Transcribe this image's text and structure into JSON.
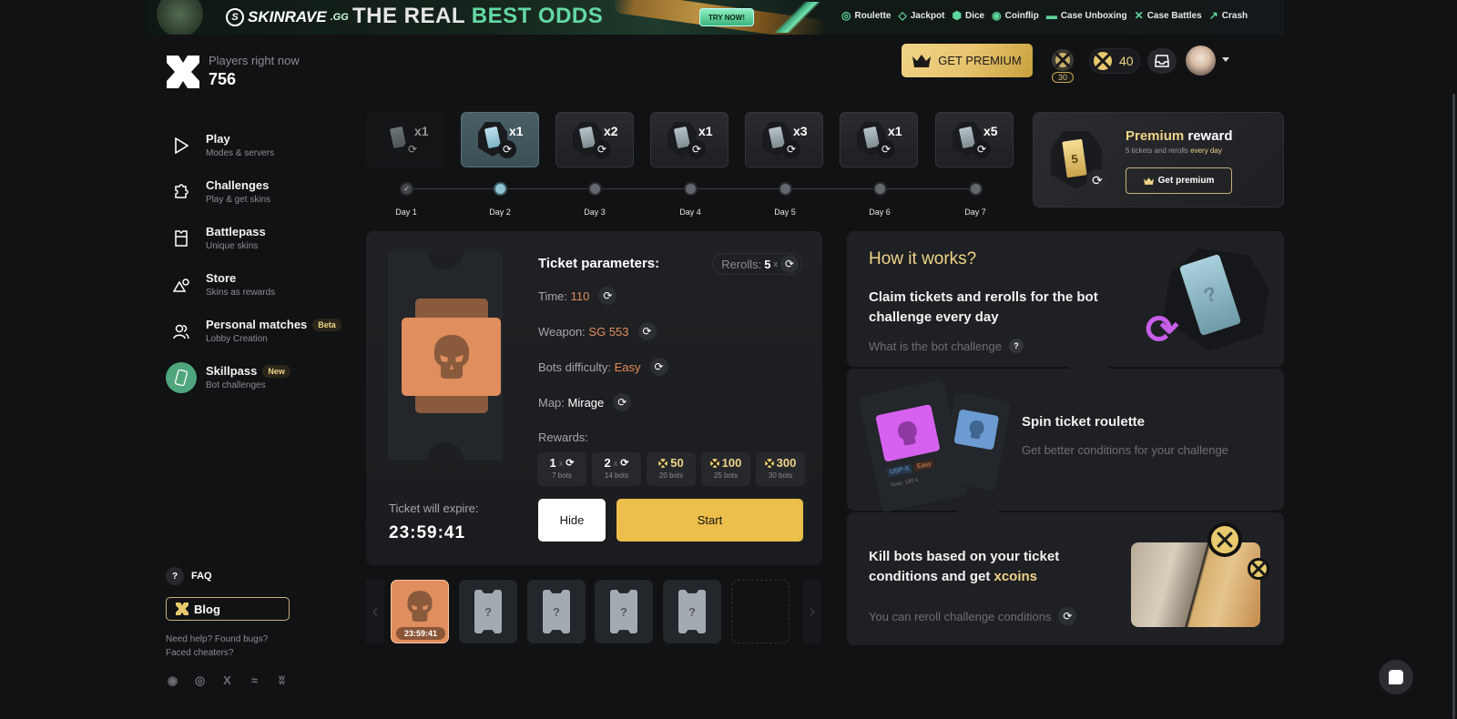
{
  "banner": {
    "brand": "SKINRAVE",
    "brand_suffix": ".GG",
    "headline_white": "THE REAL ",
    "headline_green": "BEST ODDS",
    "cta": "TRY NOW!",
    "games": [
      {
        "label": "Roulette",
        "icon": "roulette-icon"
      },
      {
        "label": "Jackpot",
        "icon": "diamond-icon"
      },
      {
        "label": "Dice",
        "icon": "dice-icon"
      },
      {
        "label": "Coinflip",
        "icon": "coin-icon"
      },
      {
        "label": "Case Unboxing",
        "icon": "case-icon"
      },
      {
        "label": "Case Battles",
        "icon": "swords-icon"
      },
      {
        "label": "Crash",
        "icon": "rocket-icon"
      }
    ]
  },
  "header": {
    "players_label": "Players right now",
    "players_count": "756",
    "premium_button": "GET PREMIUM",
    "level_badge": "30",
    "coins": "40"
  },
  "nav": [
    {
      "title": "Play",
      "sub": "Modes & servers",
      "icon": "play-icon"
    },
    {
      "title": "Challenges",
      "sub": "Play & get skins",
      "icon": "puzzle-icon"
    },
    {
      "title": "Battlepass",
      "sub": "Unique skins",
      "icon": "battlepass-icon"
    },
    {
      "title": "Store",
      "sub": "Skins as rewards",
      "icon": "shapes-icon"
    },
    {
      "title": "Personal matches",
      "sub": "Lobby Creation",
      "tag": "Beta",
      "icon": "users-icon"
    },
    {
      "title": "Skillpass",
      "sub": "Bot challenges",
      "tag": "New",
      "icon": "ticket-icon"
    }
  ],
  "footer": {
    "faq": "FAQ",
    "blog": "Blog",
    "help_line1": "Need help? Found bugs?",
    "help_line2": "Faced cheaters?",
    "social": [
      "discord",
      "instagram",
      "x",
      "steam",
      "vk"
    ]
  },
  "days": [
    {
      "label": "Day 1",
      "mult": "x1",
      "state": "done"
    },
    {
      "label": "Day 2",
      "mult": "x1",
      "state": "active"
    },
    {
      "label": "Day 3",
      "mult": "x2",
      "state": "upcoming"
    },
    {
      "label": "Day 4",
      "mult": "x1",
      "state": "upcoming"
    },
    {
      "label": "Day 5",
      "mult": "x3",
      "state": "upcoming"
    },
    {
      "label": "Day 6",
      "mult": "x1",
      "state": "upcoming"
    },
    {
      "label": "Day 7",
      "mult": "x5",
      "state": "upcoming"
    }
  ],
  "premium_card": {
    "title_gold": "Premium",
    "title_white": " reward",
    "sub_plain": "5 tickets and rerolls ",
    "sub_gold": "every day",
    "ticket_count": "5",
    "button": "Get premium"
  },
  "ticket": {
    "title": "Ticket parameters:",
    "rerolls_label": "Rerolls:",
    "rerolls_count": "5",
    "rerolls_x": "x",
    "params": [
      {
        "label": "Time:",
        "value": "110",
        "style": "accent"
      },
      {
        "label": "Weapon:",
        "value": "SG 553",
        "style": "accent"
      },
      {
        "label": "Bots difficulty:",
        "value": "Easy",
        "style": "accent"
      },
      {
        "label": "Map:",
        "value": "Mirage",
        "style": "white"
      }
    ],
    "rewards_label": "Rewards:",
    "rewards": [
      {
        "amount": "1",
        "type": "reroll",
        "bots": "7 bots"
      },
      {
        "amount": "2",
        "type": "reroll",
        "bots": "14 bots"
      },
      {
        "amount": "50",
        "type": "coin",
        "bots": "20 bots"
      },
      {
        "amount": "100",
        "type": "coin",
        "bots": "25 bots"
      },
      {
        "amount": "300",
        "type": "coin",
        "bots": "30 bots"
      }
    ],
    "expire_label": "Ticket will expire:",
    "expire_value": "23:59:41",
    "hide_button": "Hide",
    "start_button": "Start"
  },
  "carousel": {
    "selected_time": "23:59:41",
    "unknown_count": 4,
    "placeholder": "?"
  },
  "how": {
    "heading": "How it works?",
    "step1_title": "Claim tickets and rerolls for the bot challenge every day",
    "step1_link": "What is the bot challenge",
    "step2_title": "Spin ticket roulette",
    "step2_sub": "Get better conditions for your challenge",
    "step2_tag1": "USP-S",
    "step2_tag2": "Easy",
    "step2_time": "Time: 180 s",
    "step3_title_plain": "Kill bots based on your ticket conditions and get ",
    "step3_title_gold": "xcoins",
    "step3_sub": "You can reroll challenge conditions"
  },
  "colors": {
    "accent_gold": "#f0d488",
    "start_yellow": "#ecbe4b",
    "param_orange": "#e58c5c",
    "ticket_orange": "#e08e5e",
    "active_day": "#8fc3d4",
    "skillpass_green": "#4fa67c",
    "background": "#111214"
  }
}
